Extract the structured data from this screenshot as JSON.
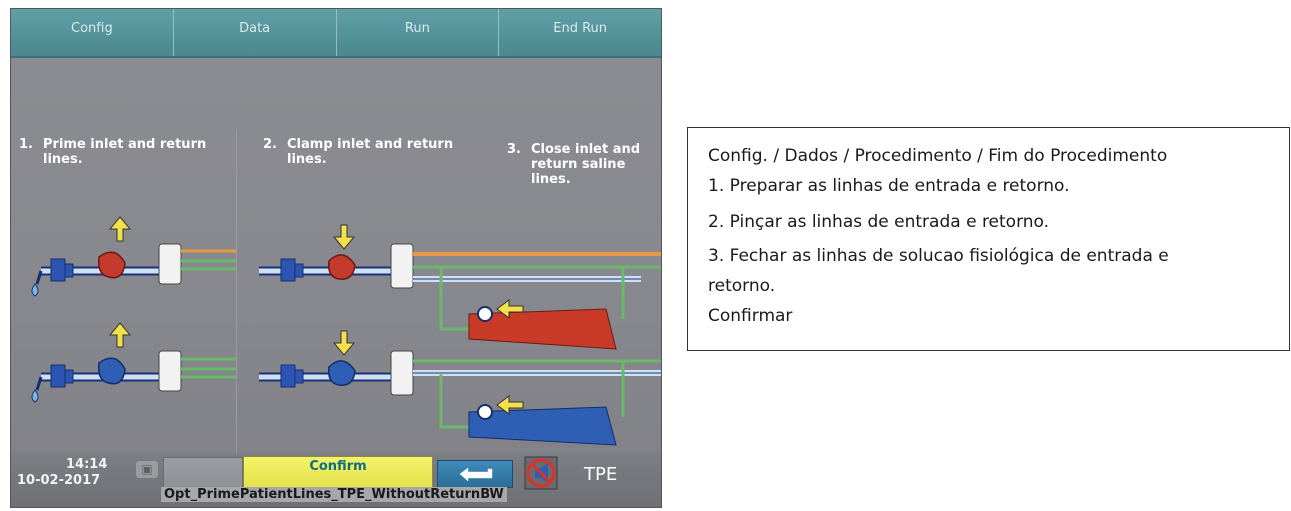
{
  "device": {
    "tabs": [
      "Config",
      "Data",
      "Run",
      "End Run"
    ],
    "steps": [
      {
        "num": "1.",
        "lines": [
          "Prime inlet and return",
          "lines."
        ]
      },
      {
        "num": "2.",
        "lines": [
          "Clamp inlet and return",
          "lines."
        ]
      },
      {
        "num": "3.",
        "lines": [
          "Close inlet and",
          "return saline",
          "lines."
        ]
      }
    ],
    "status": {
      "time": "14:14",
      "date": "10-02-2017",
      "confirm_label": "Confirm",
      "mode": "TPE",
      "screen_id": "Opt_PrimePatientLines_TPE_WithoutReturnBW"
    },
    "colors": {
      "tab_bar": "#5795a0",
      "background": "#8a8b90",
      "inlet_red": "#c43a2c",
      "return_blue": "#2f5fb5",
      "orange_line": "#e99845",
      "green_line": "#6ab86a",
      "arrow_yellow": "#f4e04a",
      "confirm_yellow": "#eeec5a"
    },
    "icons": [
      "camera-icon",
      "back-arrow-icon",
      "no-sound-icon",
      "up-arrow-icon",
      "down-arrow-icon",
      "left-arrow-icon"
    ]
  },
  "translation": {
    "lines": [
      "Config. / Dados / Procedimento / Fim do Procedimento",
      "1. Preparar as linhas de entrada e retorno.",
      "2. Pinçar as linhas de entrada e retorno.",
      "3. Fechar as linhas de solucao fisiológica de entrada e",
      "retorno.",
      "Confirmar"
    ]
  }
}
